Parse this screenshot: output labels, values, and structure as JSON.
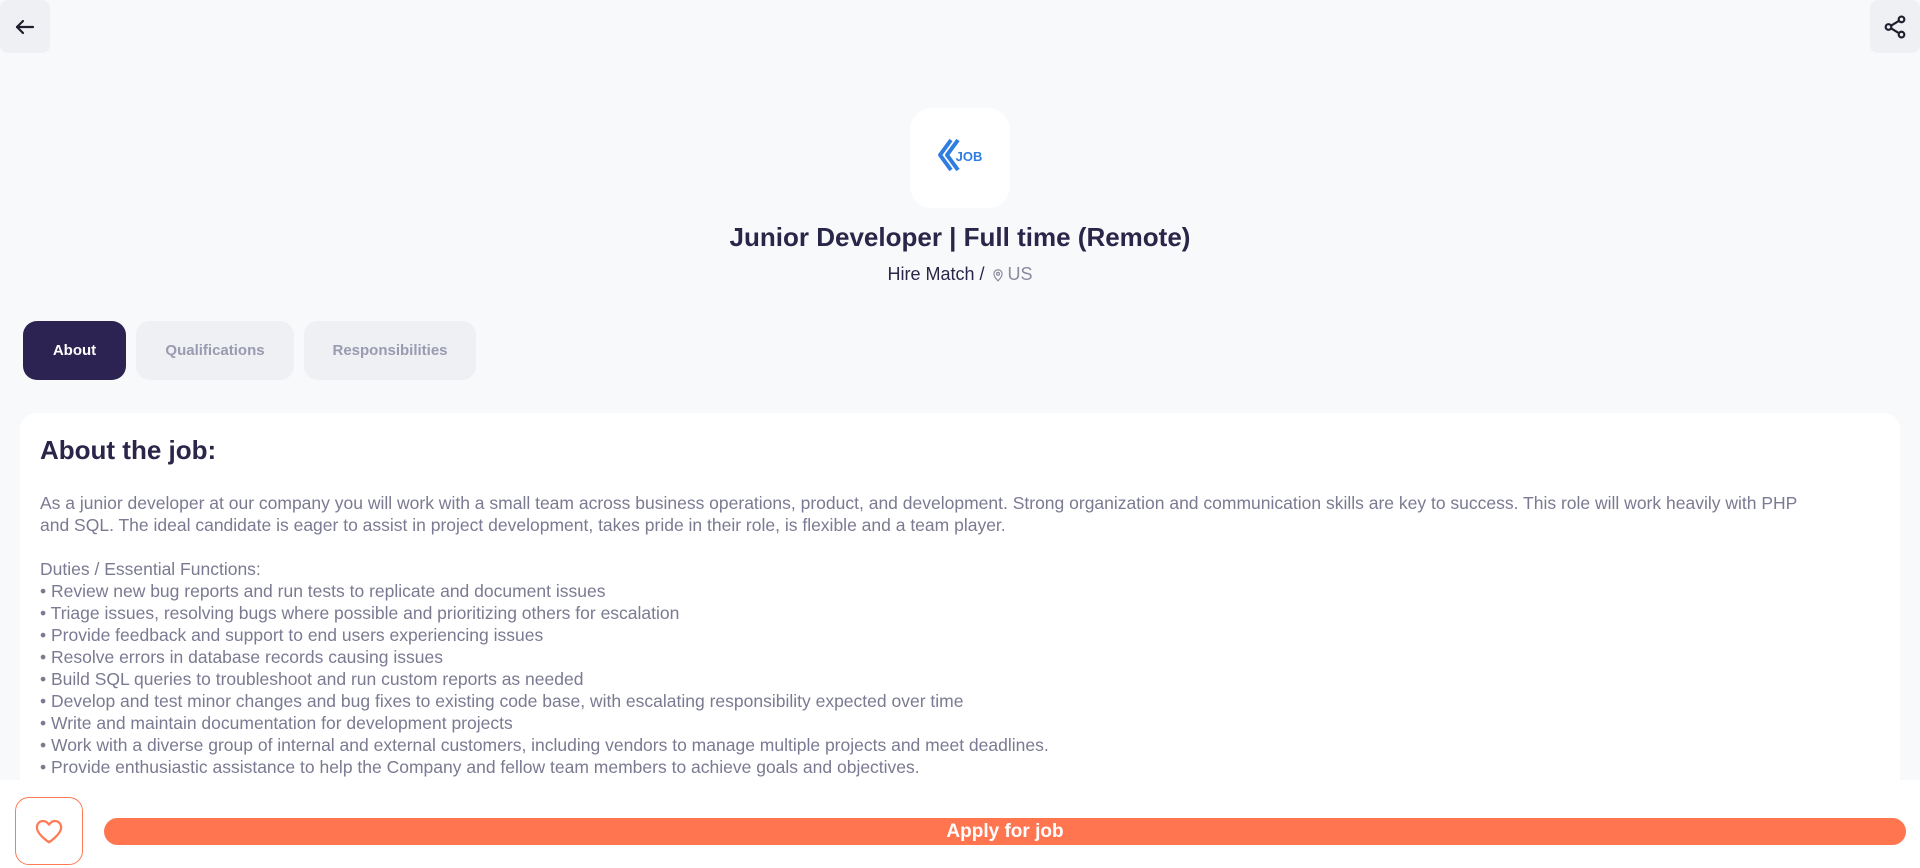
{
  "header": {
    "back_icon": "arrow-left-icon",
    "share_icon": "share-icon"
  },
  "job": {
    "logo_text": "JOB",
    "title": "Junior Developer | Full time (Remote)",
    "company": "Hire Match",
    "separator": "/",
    "location_icon": "map-pin-icon",
    "location": "US"
  },
  "tabs": [
    {
      "label": "About",
      "active": true
    },
    {
      "label": "Qualifications",
      "active": false
    },
    {
      "label": "Responsibilities",
      "active": false
    }
  ],
  "about": {
    "heading": "About the job:",
    "lines": [
      "As a junior developer at our company you will work with a small team across business operations, product, and development. Strong organization and communication skills are key to success. This role will work heavily with PHP",
      "and SQL. The ideal candidate is eager to assist in project development, takes pride in their role, is flexible and a team player.",
      "",
      "Duties / Essential Functions:",
      "• Review new bug reports and run tests to replicate and document issues",
      "• Triage issues, resolving bugs where possible and prioritizing others for escalation",
      "• Provide feedback and support to end users experiencing issues",
      "• Resolve errors in database records causing issues",
      "• Build SQL queries to troubleshoot and run custom reports as needed",
      "• Develop and test minor changes and bug fixes to existing code base, with escalating responsibility expected over time",
      "• Write and maintain documentation for development projects",
      "• Work with a diverse group of internal and external customers, including vendors to manage multiple projects and meet deadlines.",
      "• Provide enthusiastic assistance to help the Company and fellow team members to achieve goals and objectives."
    ]
  },
  "footer": {
    "favorite_icon": "heart-icon",
    "apply_label": "Apply for job"
  },
  "colors": {
    "accent": "#ff7550",
    "primary": "#2d2352",
    "logo_blue": "#2f7de1"
  }
}
